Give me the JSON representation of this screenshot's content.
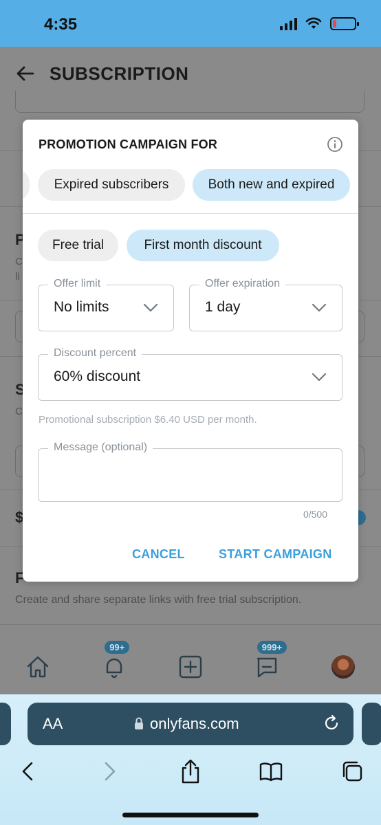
{
  "status_bar": {
    "time": "4:35"
  },
  "page": {
    "title": "SUBSCRIPTION",
    "bg_letter_1": "P",
    "bg_letter_2": "S",
    "bg_letter_3": "$",
    "bg_letter_4": "F",
    "bg_small_1": "C",
    "bg_small_2": "li",
    "bg_small_3": "C",
    "footer_text": "Create and share separate links with free trial subscription."
  },
  "app_nav": {
    "notifications_badge": "99+",
    "messages_badge": "999+"
  },
  "modal": {
    "title": "PROMOTION CAMPAIGN FOR",
    "audience_chips": [
      "Expired subscribers",
      "Both new and expired"
    ],
    "type_chips": [
      "Free trial",
      "First month discount"
    ],
    "offer_limit": {
      "label": "Offer limit",
      "value": "No limits"
    },
    "offer_expiration": {
      "label": "Offer expiration",
      "value": "1 day"
    },
    "discount_percent": {
      "label": "Discount percent",
      "value": "60% discount"
    },
    "helper": "Promotional subscription $6.40 USD per month.",
    "message": {
      "label": "Message (optional)",
      "value": ""
    },
    "counter": "0/500",
    "cancel": "CANCEL",
    "start": "START CAMPAIGN"
  },
  "safari": {
    "aa": "AA",
    "url": "onlyfans.com"
  },
  "colors": {
    "accent": "#3aa0dc",
    "chip_active": "#cde9f9",
    "chip_inactive": "#eeeeef",
    "status_bar": "#56aee6"
  }
}
